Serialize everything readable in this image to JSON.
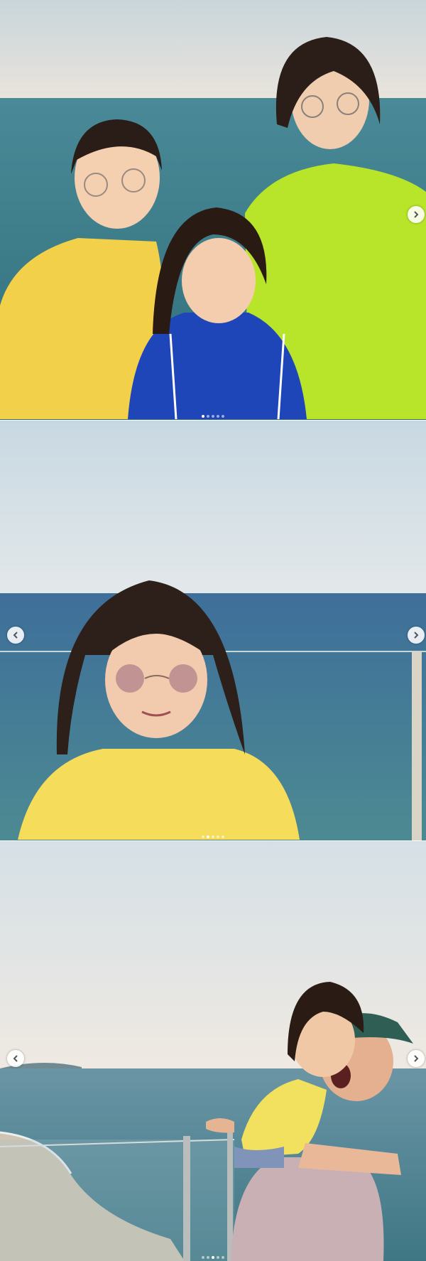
{
  "gallery": {
    "slides": [
      {
        "name": "three-girls-by-sea",
        "dot_count": 5,
        "active_dot": 0,
        "show_prev": false,
        "show_next": true
      },
      {
        "name": "girl-in-sunglasses",
        "dot_count": 5,
        "active_dot": 1,
        "show_prev": true,
        "show_next": true
      },
      {
        "name": "man-holding-girl",
        "dot_count": 5,
        "active_dot": 2,
        "show_prev": true,
        "show_next": true
      }
    ],
    "icons": {
      "prev": "chevron-left-icon",
      "next": "chevron-right-icon"
    },
    "colors": {
      "sky": "#d6e2ea",
      "sea": "#3f7f95",
      "yellow_shirt": "#f3d54a",
      "lime_shirt": "#b7e62a",
      "blue_jacket": "#1f46b8"
    }
  }
}
